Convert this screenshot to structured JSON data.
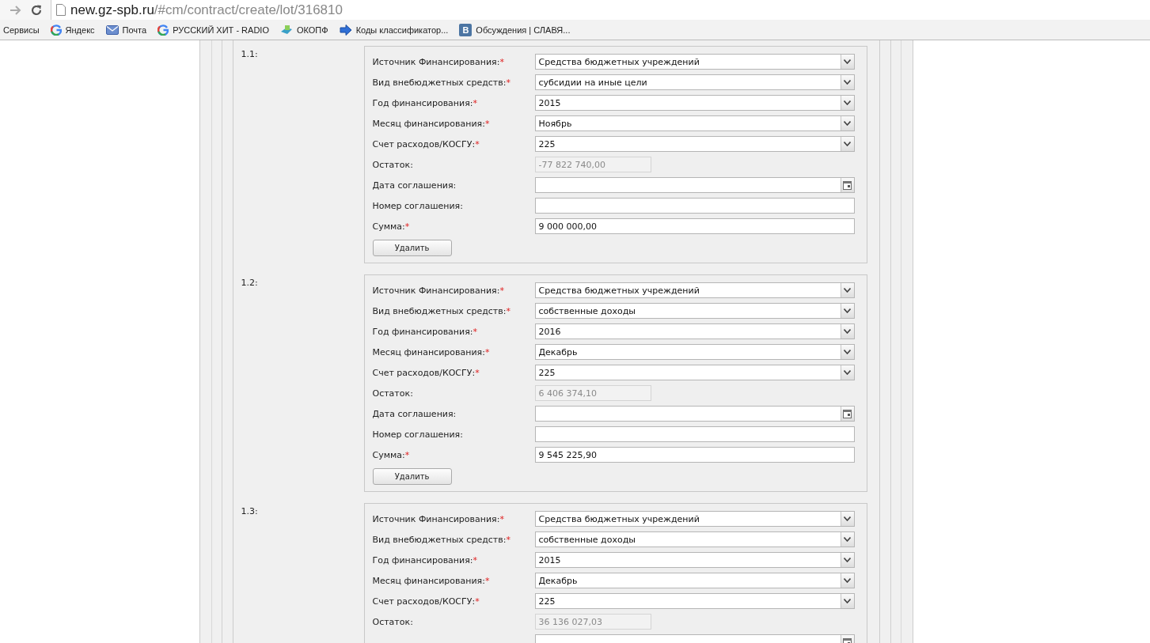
{
  "browser": {
    "url_host": "new.gz-spb.ru",
    "url_path": "/#cm/contract/create/lot/316810"
  },
  "bookmarks": [
    {
      "label": "Сервисы",
      "kind": "plain"
    },
    {
      "label": "Яндекс",
      "kind": "google"
    },
    {
      "label": "Почта",
      "kind": "mail"
    },
    {
      "label": "РУССКИЙ ХИТ - RADIO",
      "kind": "google"
    },
    {
      "label": "ОКОПФ",
      "kind": "site"
    },
    {
      "label": "Коды классификатор...",
      "kind": "arrow"
    },
    {
      "label": "Обсуждения | СЛАВЯ...",
      "kind": "vk",
      "badge": "В"
    }
  ],
  "blocks": [
    {
      "number": "1.1:",
      "delete_button": "Удалить",
      "fields": [
        {
          "label": "Источник Финансирования:",
          "asterisk": "*",
          "kind": "select",
          "value": "Средства бюджетных учреждений"
        },
        {
          "label": "Вид внебюджетных средств:",
          "asterisk": "*",
          "kind": "select",
          "value": "субсидии на иные цели"
        },
        {
          "label": "Год финансирования:",
          "asterisk": "*",
          "kind": "select",
          "value": "2015"
        },
        {
          "label": "Месяц финансирования:",
          "asterisk": "*",
          "kind": "select",
          "value": "Ноябрь"
        },
        {
          "label": "Счет расходов/КОСГУ:",
          "asterisk": "*",
          "kind": "select",
          "value": "225"
        },
        {
          "label": "Остаток:",
          "kind": "readonly",
          "value": "-77 822 740,00"
        },
        {
          "label": "Дата соглашения:",
          "kind": "date"
        },
        {
          "label": "Номер соглашения:",
          "kind": "text"
        },
        {
          "label": "Сумма:",
          "asterisk": "*",
          "kind": "text",
          "value": "9 000 000,00"
        }
      ]
    },
    {
      "number": "1.2:",
      "delete_button": "Удалить",
      "fields": [
        {
          "label": "Источник Финансирования:",
          "asterisk": "*",
          "kind": "select",
          "value": "Средства бюджетных учреждений"
        },
        {
          "label": "Вид внебюджетных средств:",
          "asterisk": "*",
          "kind": "select",
          "value": "собственные доходы"
        },
        {
          "label": "Год финансирования:",
          "asterisk": "*",
          "kind": "select",
          "value": "2016"
        },
        {
          "label": "Месяц финансирования:",
          "asterisk": "*",
          "kind": "select",
          "value": "Декабрь"
        },
        {
          "label": "Счет расходов/КОСГУ:",
          "asterisk": "*",
          "kind": "select",
          "value": "225"
        },
        {
          "label": "Остаток:",
          "kind": "readonly",
          "value": "6 406 374,10"
        },
        {
          "label": "Дата соглашения:",
          "kind": "date"
        },
        {
          "label": "Номер соглашения:",
          "kind": "text"
        },
        {
          "label": "Сумма:",
          "asterisk": "*",
          "kind": "text",
          "value": "9 545 225,90"
        }
      ]
    },
    {
      "number": "1.3:",
      "fields": [
        {
          "label": "Источник Финансирования:",
          "asterisk": "*",
          "kind": "select",
          "value": "Средства бюджетных учреждений"
        },
        {
          "label": "Вид внебюджетных средств:",
          "asterisk": "*",
          "kind": "select",
          "value": "собственные доходы"
        },
        {
          "label": "Год финансирования:",
          "asterisk": "*",
          "kind": "select",
          "value": "2015"
        },
        {
          "label": "Месяц финансирования:",
          "asterisk": "*",
          "kind": "select",
          "value": "Декабрь"
        },
        {
          "label": "Счет расходов/КОСГУ:",
          "asterisk": "*",
          "kind": "select",
          "value": "225"
        },
        {
          "label": "Остаток:",
          "kind": "readonly",
          "value": "36 136 027,03"
        },
        {
          "kind": "date"
        }
      ]
    }
  ]
}
